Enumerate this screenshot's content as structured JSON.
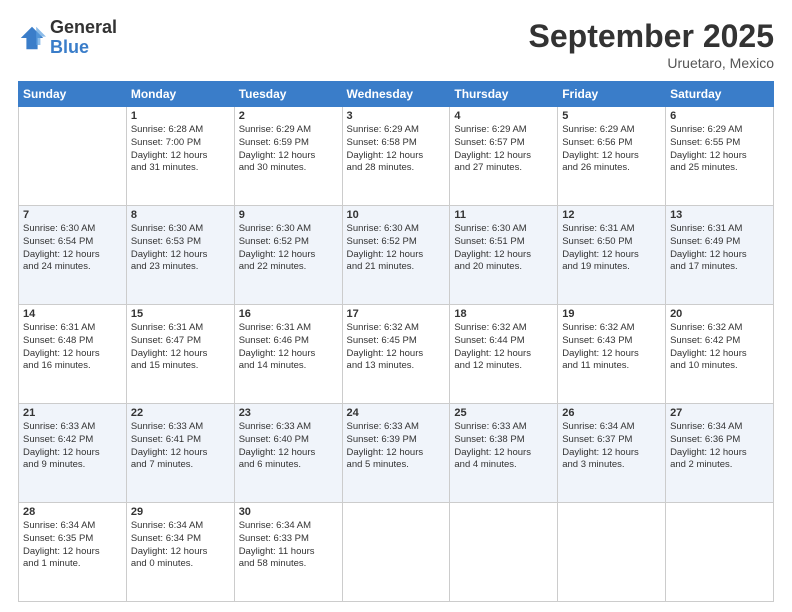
{
  "header": {
    "logo_general": "General",
    "logo_blue": "Blue",
    "month_title": "September 2025",
    "subtitle": "Uruetaro, Mexico"
  },
  "weekdays": [
    "Sunday",
    "Monday",
    "Tuesday",
    "Wednesday",
    "Thursday",
    "Friday",
    "Saturday"
  ],
  "weeks": [
    [
      {
        "day": "",
        "content": ""
      },
      {
        "day": "1",
        "content": "Sunrise: 6:28 AM\nSunset: 7:00 PM\nDaylight: 12 hours\nand 31 minutes."
      },
      {
        "day": "2",
        "content": "Sunrise: 6:29 AM\nSunset: 6:59 PM\nDaylight: 12 hours\nand 30 minutes."
      },
      {
        "day": "3",
        "content": "Sunrise: 6:29 AM\nSunset: 6:58 PM\nDaylight: 12 hours\nand 28 minutes."
      },
      {
        "day": "4",
        "content": "Sunrise: 6:29 AM\nSunset: 6:57 PM\nDaylight: 12 hours\nand 27 minutes."
      },
      {
        "day": "5",
        "content": "Sunrise: 6:29 AM\nSunset: 6:56 PM\nDaylight: 12 hours\nand 26 minutes."
      },
      {
        "day": "6",
        "content": "Sunrise: 6:29 AM\nSunset: 6:55 PM\nDaylight: 12 hours\nand 25 minutes."
      }
    ],
    [
      {
        "day": "7",
        "content": "Sunrise: 6:30 AM\nSunset: 6:54 PM\nDaylight: 12 hours\nand 24 minutes."
      },
      {
        "day": "8",
        "content": "Sunrise: 6:30 AM\nSunset: 6:53 PM\nDaylight: 12 hours\nand 23 minutes."
      },
      {
        "day": "9",
        "content": "Sunrise: 6:30 AM\nSunset: 6:52 PM\nDaylight: 12 hours\nand 22 minutes."
      },
      {
        "day": "10",
        "content": "Sunrise: 6:30 AM\nSunset: 6:52 PM\nDaylight: 12 hours\nand 21 minutes."
      },
      {
        "day": "11",
        "content": "Sunrise: 6:30 AM\nSunset: 6:51 PM\nDaylight: 12 hours\nand 20 minutes."
      },
      {
        "day": "12",
        "content": "Sunrise: 6:31 AM\nSunset: 6:50 PM\nDaylight: 12 hours\nand 19 minutes."
      },
      {
        "day": "13",
        "content": "Sunrise: 6:31 AM\nSunset: 6:49 PM\nDaylight: 12 hours\nand 17 minutes."
      }
    ],
    [
      {
        "day": "14",
        "content": "Sunrise: 6:31 AM\nSunset: 6:48 PM\nDaylight: 12 hours\nand 16 minutes."
      },
      {
        "day": "15",
        "content": "Sunrise: 6:31 AM\nSunset: 6:47 PM\nDaylight: 12 hours\nand 15 minutes."
      },
      {
        "day": "16",
        "content": "Sunrise: 6:31 AM\nSunset: 6:46 PM\nDaylight: 12 hours\nand 14 minutes."
      },
      {
        "day": "17",
        "content": "Sunrise: 6:32 AM\nSunset: 6:45 PM\nDaylight: 12 hours\nand 13 minutes."
      },
      {
        "day": "18",
        "content": "Sunrise: 6:32 AM\nSunset: 6:44 PM\nDaylight: 12 hours\nand 12 minutes."
      },
      {
        "day": "19",
        "content": "Sunrise: 6:32 AM\nSunset: 6:43 PM\nDaylight: 12 hours\nand 11 minutes."
      },
      {
        "day": "20",
        "content": "Sunrise: 6:32 AM\nSunset: 6:42 PM\nDaylight: 12 hours\nand 10 minutes."
      }
    ],
    [
      {
        "day": "21",
        "content": "Sunrise: 6:33 AM\nSunset: 6:42 PM\nDaylight: 12 hours\nand 9 minutes."
      },
      {
        "day": "22",
        "content": "Sunrise: 6:33 AM\nSunset: 6:41 PM\nDaylight: 12 hours\nand 7 minutes."
      },
      {
        "day": "23",
        "content": "Sunrise: 6:33 AM\nSunset: 6:40 PM\nDaylight: 12 hours\nand 6 minutes."
      },
      {
        "day": "24",
        "content": "Sunrise: 6:33 AM\nSunset: 6:39 PM\nDaylight: 12 hours\nand 5 minutes."
      },
      {
        "day": "25",
        "content": "Sunrise: 6:33 AM\nSunset: 6:38 PM\nDaylight: 12 hours\nand 4 minutes."
      },
      {
        "day": "26",
        "content": "Sunrise: 6:34 AM\nSunset: 6:37 PM\nDaylight: 12 hours\nand 3 minutes."
      },
      {
        "day": "27",
        "content": "Sunrise: 6:34 AM\nSunset: 6:36 PM\nDaylight: 12 hours\nand 2 minutes."
      }
    ],
    [
      {
        "day": "28",
        "content": "Sunrise: 6:34 AM\nSunset: 6:35 PM\nDaylight: 12 hours\nand 1 minute."
      },
      {
        "day": "29",
        "content": "Sunrise: 6:34 AM\nSunset: 6:34 PM\nDaylight: 12 hours\nand 0 minutes."
      },
      {
        "day": "30",
        "content": "Sunrise: 6:34 AM\nSunset: 6:33 PM\nDaylight: 11 hours\nand 58 minutes."
      },
      {
        "day": "",
        "content": ""
      },
      {
        "day": "",
        "content": ""
      },
      {
        "day": "",
        "content": ""
      },
      {
        "day": "",
        "content": ""
      }
    ]
  ]
}
